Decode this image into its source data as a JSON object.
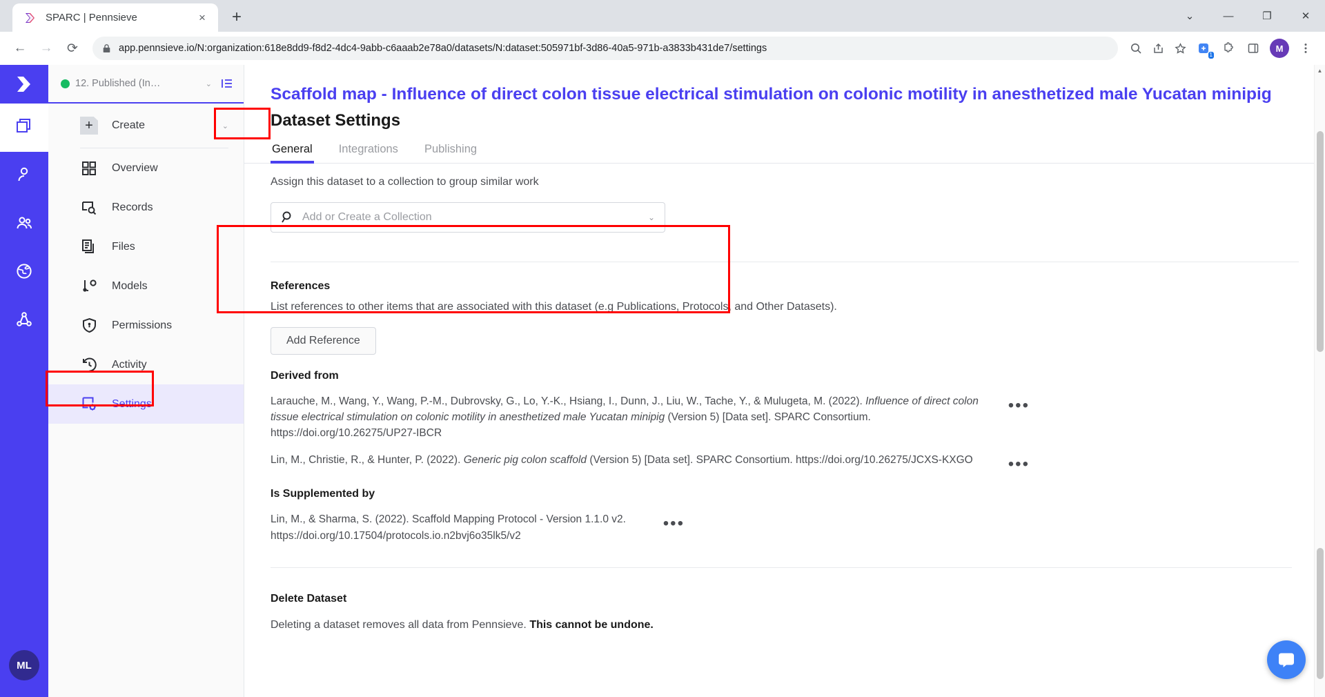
{
  "browser": {
    "tab": {
      "title": "SPARC | Pennsieve",
      "favicon": "pennsieve-logo-icon",
      "close": "×"
    },
    "newtab_label": "+",
    "window_controls": {
      "minimize": "—",
      "maximize": "❐",
      "close": "✕",
      "more": "⌄"
    },
    "nav": {
      "back": "←",
      "forward": "→",
      "reload": "⟳"
    },
    "omnibox": {
      "url": "app.pennsieve.io/N:organization:618e8dd9-f8d2-4dc4-9abb-c6aaab2e78a0/datasets/N:dataset:505971bf-3d86-40a5-971b-a3833b431de7/settings",
      "lock": "lock-icon",
      "search_icon": "search-icon",
      "share_icon": "share-icon",
      "bookmark_icon": "star-icon"
    },
    "toolbar_icons": [
      "extension-puzzle-icon",
      "split-view-icon",
      "profile-avatar"
    ],
    "extension_badge": "1",
    "profile_initial": "M"
  },
  "rail": {
    "logo": "pennsieve-logo-icon",
    "items": [
      {
        "name": "datasets-icon",
        "active": true
      },
      {
        "name": "person-icon",
        "active": false
      },
      {
        "name": "people-icon",
        "active": false
      },
      {
        "name": "globe-icon",
        "active": false
      },
      {
        "name": "graph-icon",
        "active": false
      }
    ],
    "avatar_initials": "ML"
  },
  "sidebar": {
    "dataset_switcher": {
      "status": "published",
      "status_color": "#17bb62",
      "label": "12. Published (In…",
      "caret": "⌄",
      "collapse_icon": "collapse-sidebar-icon"
    },
    "create_label": "Create",
    "create_caret": "⌄",
    "items": [
      {
        "label": "Overview",
        "icon": "grid-icon",
        "active": false
      },
      {
        "label": "Records",
        "icon": "records-search-icon",
        "active": false
      },
      {
        "label": "Files",
        "icon": "files-icon",
        "active": false
      },
      {
        "label": "Models",
        "icon": "models-node-icon",
        "active": false
      },
      {
        "label": "Permissions",
        "icon": "shield-lock-icon",
        "active": false
      },
      {
        "label": "Activity",
        "icon": "history-clock-icon",
        "active": false
      },
      {
        "label": "Settings",
        "icon": "settings-gear-icon",
        "active": true
      }
    ],
    "bottom_icons": [
      "search-icon",
      "feedback-chat-icon"
    ]
  },
  "main": {
    "dataset_title": "Scaffold map - Influence of direct colon tissue electrical stimulation on colonic motility in anesthetized male Yucatan minipig",
    "page_heading": "Dataset Settings",
    "tabs": [
      {
        "label": "General",
        "active": true
      },
      {
        "label": "Integrations",
        "active": false
      },
      {
        "label": "Publishing",
        "active": false
      }
    ],
    "collection": {
      "hint": "Assign this dataset to a collection to group similar work",
      "placeholder": "Add or Create a Collection",
      "search_icon": "search-icon",
      "caret": "⌄"
    },
    "references": {
      "title": "References",
      "description": "List references to other items that are associated with this dataset (e.g Publications, Protocols, and Other Datasets).",
      "add_button": "Add Reference"
    },
    "reference_groups": [
      {
        "label": "Derived from",
        "entries": [
          {
            "pre": "Larauche, M., Wang, Y., Wang, P.-M., Dubrovsky, G., Lo, Y.-K., Hsiang, I., Dunn, J., Liu, W., Tache, Y., & Mulugeta, M. (2022). ",
            "italic": "Influence of direct colon tissue electrical stimulation on colonic motility in anesthetized male Yucatan minipig",
            "post": " (Version 5) [Data set]. SPARC Consortium. https://doi.org/10.26275/UP27-IBCR",
            "menu": "•••"
          },
          {
            "pre": "Lin, M., Christie, R., & Hunter, P. (2022). ",
            "italic": "Generic pig colon scaffold",
            "post": " (Version 5) [Data set]. SPARC Consortium. https://doi.org/10.26275/JCXS-KXGO",
            "menu": "•••"
          }
        ]
      },
      {
        "label": "Is Supplemented by",
        "entries": [
          {
            "pre": "Lin, M., & Sharma, S. (2022). Scaffold Mapping Protocol - Version 1.1.0 v2. https://doi.org/10.17504/protocols.io.n2bvj6o35lk5/v2",
            "italic": "",
            "post": "",
            "menu": "•••"
          }
        ]
      }
    ],
    "delete": {
      "title": "Delete Dataset",
      "description_pre": "Deleting a dataset removes all data from Pennsieve. ",
      "description_bold": "This cannot be undone."
    }
  },
  "annotations": {
    "color": "#ff0000",
    "boxes": [
      "general-tab",
      "references-section",
      "settings-sidebar-item"
    ]
  },
  "support": {
    "icon": "intercom-chat-icon",
    "color": "#3e82f7"
  }
}
